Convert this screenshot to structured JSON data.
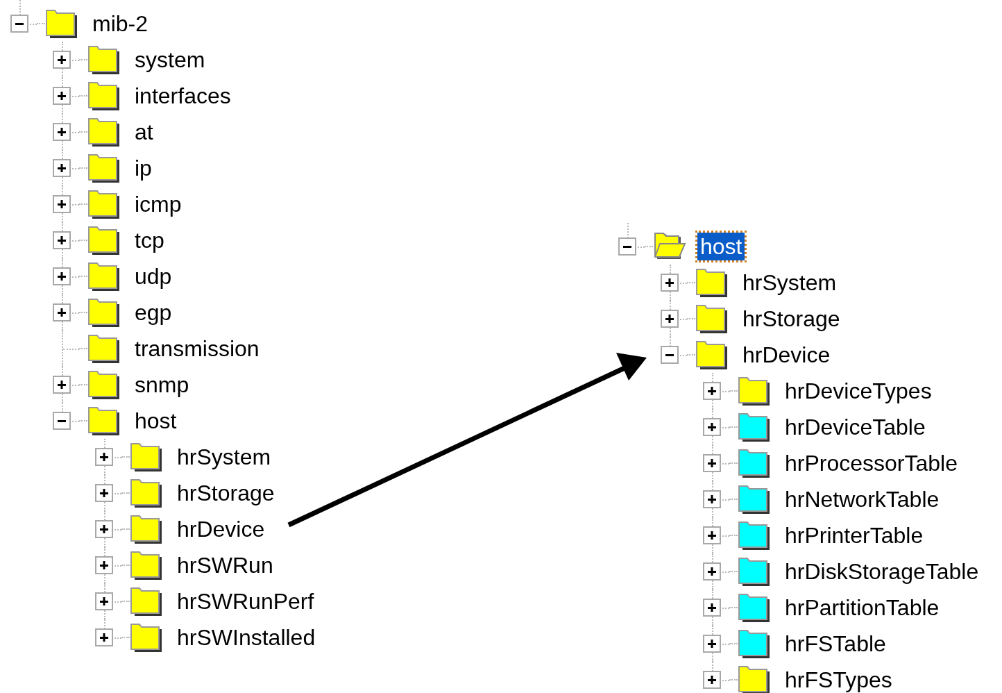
{
  "trees": [
    {
      "nodes": [
        {
          "label": "mib-2",
          "color": "#ffff00",
          "expandable": true,
          "expanded": true,
          "selected": false,
          "children": [
            {
              "label": "system",
              "color": "#ffff00",
              "expandable": true,
              "expanded": false,
              "selected": false
            },
            {
              "label": "interfaces",
              "color": "#ffff00",
              "expandable": true,
              "expanded": false,
              "selected": false
            },
            {
              "label": "at",
              "color": "#ffff00",
              "expandable": true,
              "expanded": false,
              "selected": false
            },
            {
              "label": "ip",
              "color": "#ffff00",
              "expandable": true,
              "expanded": false,
              "selected": false
            },
            {
              "label": "icmp",
              "color": "#ffff00",
              "expandable": true,
              "expanded": false,
              "selected": false
            },
            {
              "label": "tcp",
              "color": "#ffff00",
              "expandable": true,
              "expanded": false,
              "selected": false
            },
            {
              "label": "udp",
              "color": "#ffff00",
              "expandable": true,
              "expanded": false,
              "selected": false
            },
            {
              "label": "egp",
              "color": "#ffff00",
              "expandable": true,
              "expanded": false,
              "selected": false
            },
            {
              "label": "transmission",
              "color": "#ffff00",
              "expandable": false,
              "selected": false
            },
            {
              "label": "snmp",
              "color": "#ffff00",
              "expandable": true,
              "expanded": false,
              "selected": false
            },
            {
              "label": "host",
              "color": "#ffff00",
              "expandable": true,
              "expanded": true,
              "selected": false,
              "children": [
                {
                  "label": "hrSystem",
                  "color": "#ffff00",
                  "expandable": true,
                  "expanded": false,
                  "selected": false
                },
                {
                  "label": "hrStorage",
                  "color": "#ffff00",
                  "expandable": true,
                  "expanded": false,
                  "selected": false
                },
                {
                  "label": "hrDevice",
                  "color": "#ffff00",
                  "expandable": true,
                  "expanded": false,
                  "selected": false
                },
                {
                  "label": "hrSWRun",
                  "color": "#ffff00",
                  "expandable": true,
                  "expanded": false,
                  "selected": false
                },
                {
                  "label": "hrSWRunPerf",
                  "color": "#ffff00",
                  "expandable": true,
                  "expanded": false,
                  "selected": false
                },
                {
                  "label": "hrSWInstalled",
                  "color": "#ffff00",
                  "expandable": true,
                  "expanded": false,
                  "selected": false
                }
              ]
            }
          ]
        }
      ]
    },
    {
      "nodes": [
        {
          "label": "host",
          "color": "#ffff00",
          "expandable": true,
          "expanded": true,
          "selected": true,
          "children": [
            {
              "label": "hrSystem",
              "color": "#ffff00",
              "expandable": true,
              "expanded": false,
              "selected": false
            },
            {
              "label": "hrStorage",
              "color": "#ffff00",
              "expandable": true,
              "expanded": false,
              "selected": false
            },
            {
              "label": "hrDevice",
              "color": "#ffff00",
              "expandable": true,
              "expanded": true,
              "selected": false,
              "children": [
                {
                  "label": "hrDeviceTypes",
                  "color": "#ffff00",
                  "expandable": true,
                  "expanded": false,
                  "selected": false
                },
                {
                  "label": "hrDeviceTable",
                  "color": "#00ffff",
                  "expandable": true,
                  "expanded": false,
                  "selected": false
                },
                {
                  "label": "hrProcessorTable",
                  "color": "#00ffff",
                  "expandable": true,
                  "expanded": false,
                  "selected": false
                },
                {
                  "label": "hrNetworkTable",
                  "color": "#00ffff",
                  "expandable": true,
                  "expanded": false,
                  "selected": false
                },
                {
                  "label": "hrPrinterTable",
                  "color": "#00ffff",
                  "expandable": true,
                  "expanded": false,
                  "selected": false
                },
                {
                  "label": "hrDiskStorageTable",
                  "color": "#00ffff",
                  "expandable": true,
                  "expanded": false,
                  "selected": false
                },
                {
                  "label": "hrPartitionTable",
                  "color": "#00ffff",
                  "expandable": true,
                  "expanded": false,
                  "selected": false
                },
                {
                  "label": "hrFSTable",
                  "color": "#00ffff",
                  "expandable": true,
                  "expanded": false,
                  "selected": false
                },
                {
                  "label": "hrFSTypes",
                  "color": "#ffff00",
                  "expandable": true,
                  "expanded": false,
                  "selected": false
                }
              ]
            }
          ]
        }
      ]
    }
  ]
}
